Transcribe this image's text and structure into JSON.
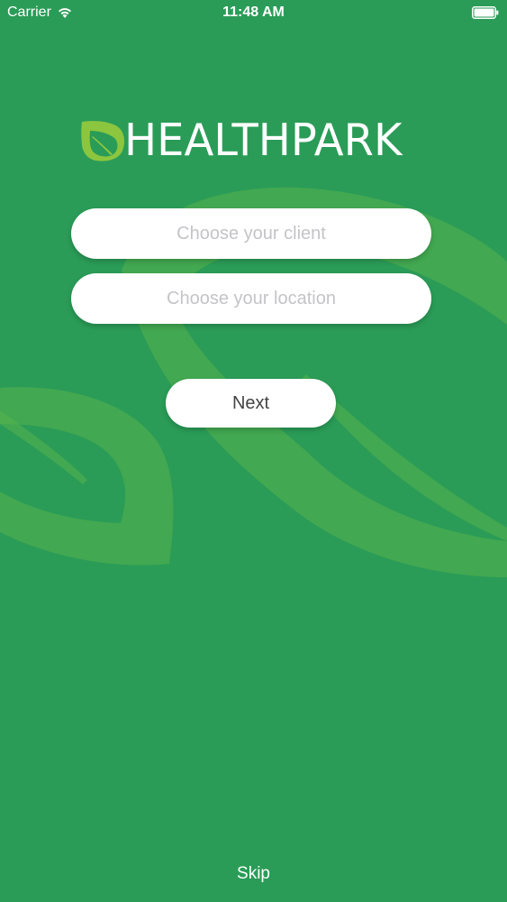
{
  "status_bar": {
    "carrier": "Carrier",
    "time": "11:48 AM",
    "wifi_icon": "wifi-icon",
    "battery_icon": "battery-icon"
  },
  "brand": {
    "name": "HEALTHPARK",
    "logo_icon": "leaf-icon",
    "leaf_color": "#8cc63f"
  },
  "form": {
    "client_placeholder": "Choose your client",
    "client_value": "",
    "location_placeholder": "Choose your location",
    "location_value": "",
    "next_label": "Next"
  },
  "footer": {
    "skip_label": "Skip"
  },
  "colors": {
    "background": "#2a9c57",
    "background_art": "#5bb84f",
    "text_on_background": "#ffffff",
    "field_background": "#ffffff",
    "placeholder": "#c4c4c8"
  }
}
